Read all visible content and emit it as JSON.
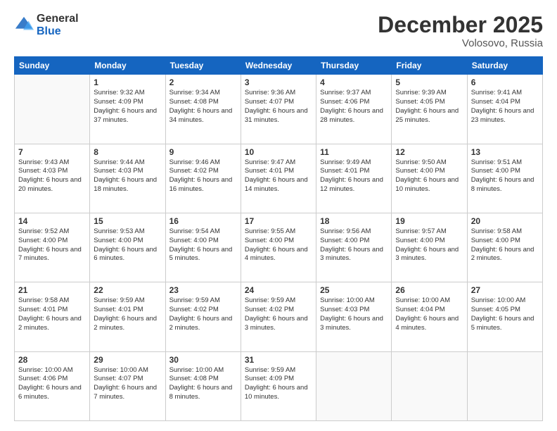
{
  "logo": {
    "general": "General",
    "blue": "Blue"
  },
  "header": {
    "month": "December 2025",
    "location": "Volosovo, Russia"
  },
  "weekdays": [
    "Sunday",
    "Monday",
    "Tuesday",
    "Wednesday",
    "Thursday",
    "Friday",
    "Saturday"
  ],
  "days": [
    {
      "date": "",
      "empty": true
    },
    {
      "date": "1",
      "sunrise": "9:32 AM",
      "sunset": "4:09 PM",
      "daylight": "6 hours and 37 minutes."
    },
    {
      "date": "2",
      "sunrise": "9:34 AM",
      "sunset": "4:08 PM",
      "daylight": "6 hours and 34 minutes."
    },
    {
      "date": "3",
      "sunrise": "9:36 AM",
      "sunset": "4:07 PM",
      "daylight": "6 hours and 31 minutes."
    },
    {
      "date": "4",
      "sunrise": "9:37 AM",
      "sunset": "4:06 PM",
      "daylight": "6 hours and 28 minutes."
    },
    {
      "date": "5",
      "sunrise": "9:39 AM",
      "sunset": "4:05 PM",
      "daylight": "6 hours and 25 minutes."
    },
    {
      "date": "6",
      "sunrise": "9:41 AM",
      "sunset": "4:04 PM",
      "daylight": "6 hours and 23 minutes."
    },
    {
      "date": "7",
      "sunrise": "9:43 AM",
      "sunset": "4:03 PM",
      "daylight": "6 hours and 20 minutes."
    },
    {
      "date": "8",
      "sunrise": "9:44 AM",
      "sunset": "4:03 PM",
      "daylight": "6 hours and 18 minutes."
    },
    {
      "date": "9",
      "sunrise": "9:46 AM",
      "sunset": "4:02 PM",
      "daylight": "6 hours and 16 minutes."
    },
    {
      "date": "10",
      "sunrise": "9:47 AM",
      "sunset": "4:01 PM",
      "daylight": "6 hours and 14 minutes."
    },
    {
      "date": "11",
      "sunrise": "9:49 AM",
      "sunset": "4:01 PM",
      "daylight": "6 hours and 12 minutes."
    },
    {
      "date": "12",
      "sunrise": "9:50 AM",
      "sunset": "4:00 PM",
      "daylight": "6 hours and 10 minutes."
    },
    {
      "date": "13",
      "sunrise": "9:51 AM",
      "sunset": "4:00 PM",
      "daylight": "6 hours and 8 minutes."
    },
    {
      "date": "14",
      "sunrise": "9:52 AM",
      "sunset": "4:00 PM",
      "daylight": "6 hours and 7 minutes."
    },
    {
      "date": "15",
      "sunrise": "9:53 AM",
      "sunset": "4:00 PM",
      "daylight": "6 hours and 6 minutes."
    },
    {
      "date": "16",
      "sunrise": "9:54 AM",
      "sunset": "4:00 PM",
      "daylight": "6 hours and 5 minutes."
    },
    {
      "date": "17",
      "sunrise": "9:55 AM",
      "sunset": "4:00 PM",
      "daylight": "6 hours and 4 minutes."
    },
    {
      "date": "18",
      "sunrise": "9:56 AM",
      "sunset": "4:00 PM",
      "daylight": "6 hours and 3 minutes."
    },
    {
      "date": "19",
      "sunrise": "9:57 AM",
      "sunset": "4:00 PM",
      "daylight": "6 hours and 3 minutes."
    },
    {
      "date": "20",
      "sunrise": "9:58 AM",
      "sunset": "4:00 PM",
      "daylight": "6 hours and 2 minutes."
    },
    {
      "date": "21",
      "sunrise": "9:58 AM",
      "sunset": "4:01 PM",
      "daylight": "6 hours and 2 minutes."
    },
    {
      "date": "22",
      "sunrise": "9:59 AM",
      "sunset": "4:01 PM",
      "daylight": "6 hours and 2 minutes."
    },
    {
      "date": "23",
      "sunrise": "9:59 AM",
      "sunset": "4:02 PM",
      "daylight": "6 hours and 2 minutes."
    },
    {
      "date": "24",
      "sunrise": "9:59 AM",
      "sunset": "4:02 PM",
      "daylight": "6 hours and 3 minutes."
    },
    {
      "date": "25",
      "sunrise": "10:00 AM",
      "sunset": "4:03 PM",
      "daylight": "6 hours and 3 minutes."
    },
    {
      "date": "26",
      "sunrise": "10:00 AM",
      "sunset": "4:04 PM",
      "daylight": "6 hours and 4 minutes."
    },
    {
      "date": "27",
      "sunrise": "10:00 AM",
      "sunset": "4:05 PM",
      "daylight": "6 hours and 5 minutes."
    },
    {
      "date": "28",
      "sunrise": "10:00 AM",
      "sunset": "4:06 PM",
      "daylight": "6 hours and 6 minutes."
    },
    {
      "date": "29",
      "sunrise": "10:00 AM",
      "sunset": "4:07 PM",
      "daylight": "6 hours and 7 minutes."
    },
    {
      "date": "30",
      "sunrise": "10:00 AM",
      "sunset": "4:08 PM",
      "daylight": "6 hours and 8 minutes."
    },
    {
      "date": "31",
      "sunrise": "9:59 AM",
      "sunset": "4:09 PM",
      "daylight": "6 hours and 10 minutes."
    },
    {
      "date": "",
      "empty": true
    },
    {
      "date": "",
      "empty": true
    },
    {
      "date": "",
      "empty": true
    }
  ]
}
